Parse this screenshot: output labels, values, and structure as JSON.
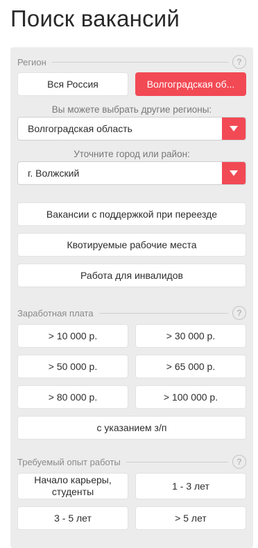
{
  "page": {
    "title": "Поиск вакансий"
  },
  "region": {
    "label": "Регион",
    "help": "?",
    "buttons": [
      "Вся Россия",
      "Волгоградская об..."
    ],
    "other_regions_hint": "Вы можете выбрать другие регионы:",
    "region_select": "Волгоградская область",
    "city_hint": "Уточните город или район:",
    "city_select": "г. Волжский",
    "options": [
      "Вакансии с поддержкой при переезде",
      "Квотируемые рабочие места",
      "Работа для инвалидов"
    ]
  },
  "salary": {
    "label": "Заработная плата",
    "help": "?",
    "buttons": [
      "> 10 000 р.",
      "> 30 000 р.",
      "> 50 000 р.",
      "> 65 000 р.",
      "> 80 000 р.",
      "> 100 000 р."
    ],
    "with_salary": "с указанием з/п"
  },
  "experience": {
    "label": "Требуемый опыт работы",
    "help": "?",
    "buttons": [
      "Начало карьеры, студенты",
      "1 - 3 лет",
      "3 - 5 лет",
      "> 5 лет"
    ]
  },
  "colors": {
    "accent": "#f24a55",
    "panel": "#ececec"
  },
  "icons": {
    "help": "question-circle-icon",
    "dropdown": "caret-down-icon"
  }
}
